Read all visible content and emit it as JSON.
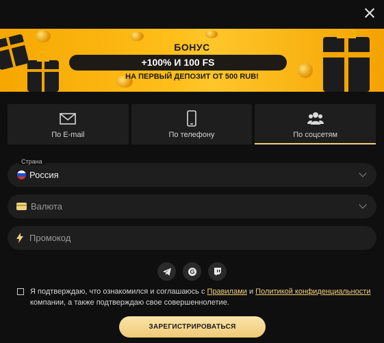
{
  "banner": {
    "title": "БОНУС",
    "offer": "+100% И 100 FS",
    "subtitle": "НА ПЕРВЫЙ ДЕПОЗИТ ОТ 500 RUB!"
  },
  "tabs": [
    {
      "label": "По E-mail",
      "icon": "envelope-icon",
      "active": false
    },
    {
      "label": "По телефону",
      "icon": "phone-icon",
      "active": false
    },
    {
      "label": "По соцсетям",
      "icon": "people-icon",
      "active": true
    }
  ],
  "form": {
    "country_label": "Страна",
    "country_value": "Россия",
    "currency_placeholder": "Валюта",
    "promo_placeholder": "Промокод"
  },
  "socials": [
    "telegram-icon",
    "google-icon",
    "twitch-icon"
  ],
  "terms": {
    "text_1": "Я подтверждаю, что ознакомился и соглашаюсь с ",
    "link_rules": "Правилами",
    "text_2": " и ",
    "link_privacy": "Политикой конфиденциальности",
    "text_3": " компании, а также подтверждаю свое совершеннолетие."
  },
  "submit_label": "ЗАРЕГИСТРИРОВАТЬСЯ",
  "colors": {
    "accent": "#f3d37a",
    "banner": "#ffbe1a",
    "background": "#0f0f10"
  }
}
